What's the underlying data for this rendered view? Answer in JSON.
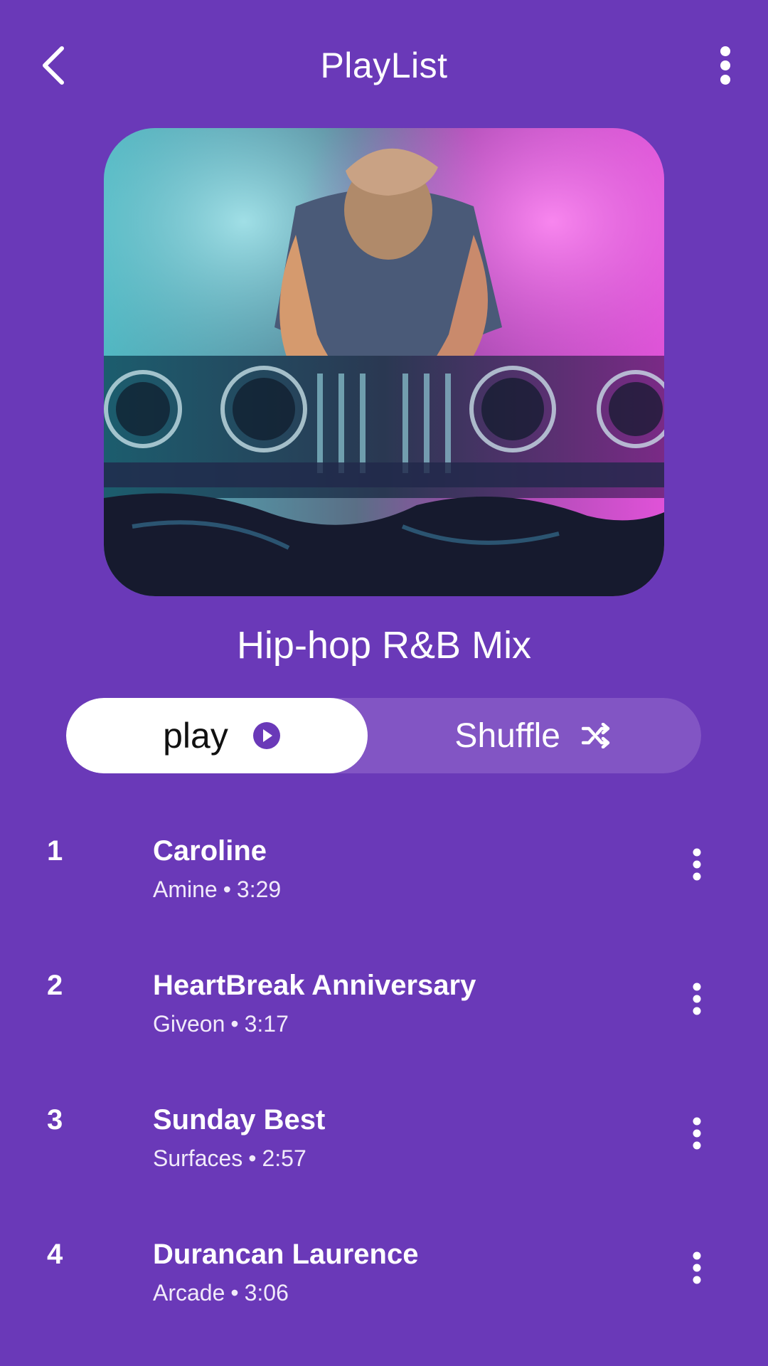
{
  "header": {
    "title": "PlayList",
    "back_icon": "chevron-left-icon",
    "more_icon": "more-vert-icon"
  },
  "cover": {
    "icon": "dj-mixer-photo"
  },
  "playlist": {
    "name": "Hip-hop R&B Mix"
  },
  "controls": {
    "play_label": "play",
    "play_icon": "play-circle-icon",
    "shuffle_label": "Shuffle",
    "shuffle_icon": "shuffle-icon"
  },
  "tracks": [
    {
      "number": "1",
      "title": "Caroline",
      "artist": "Amine",
      "duration": "3:29"
    },
    {
      "number": "2",
      "title": "HeartBreak Anniversary",
      "artist": "Giveon",
      "duration": "3:17"
    },
    {
      "number": "3",
      "title": "Sunday Best",
      "artist": "Surfaces",
      "duration": "2:57"
    },
    {
      "number": "4",
      "title": "Durancan Laurence",
      "artist": "Arcade",
      "duration": "3:06"
    }
  ],
  "colors": {
    "background": "#6a39b8",
    "shuffle_button": "#8255c4",
    "play_button": "#ffffff",
    "accent": "#6a39b8"
  }
}
